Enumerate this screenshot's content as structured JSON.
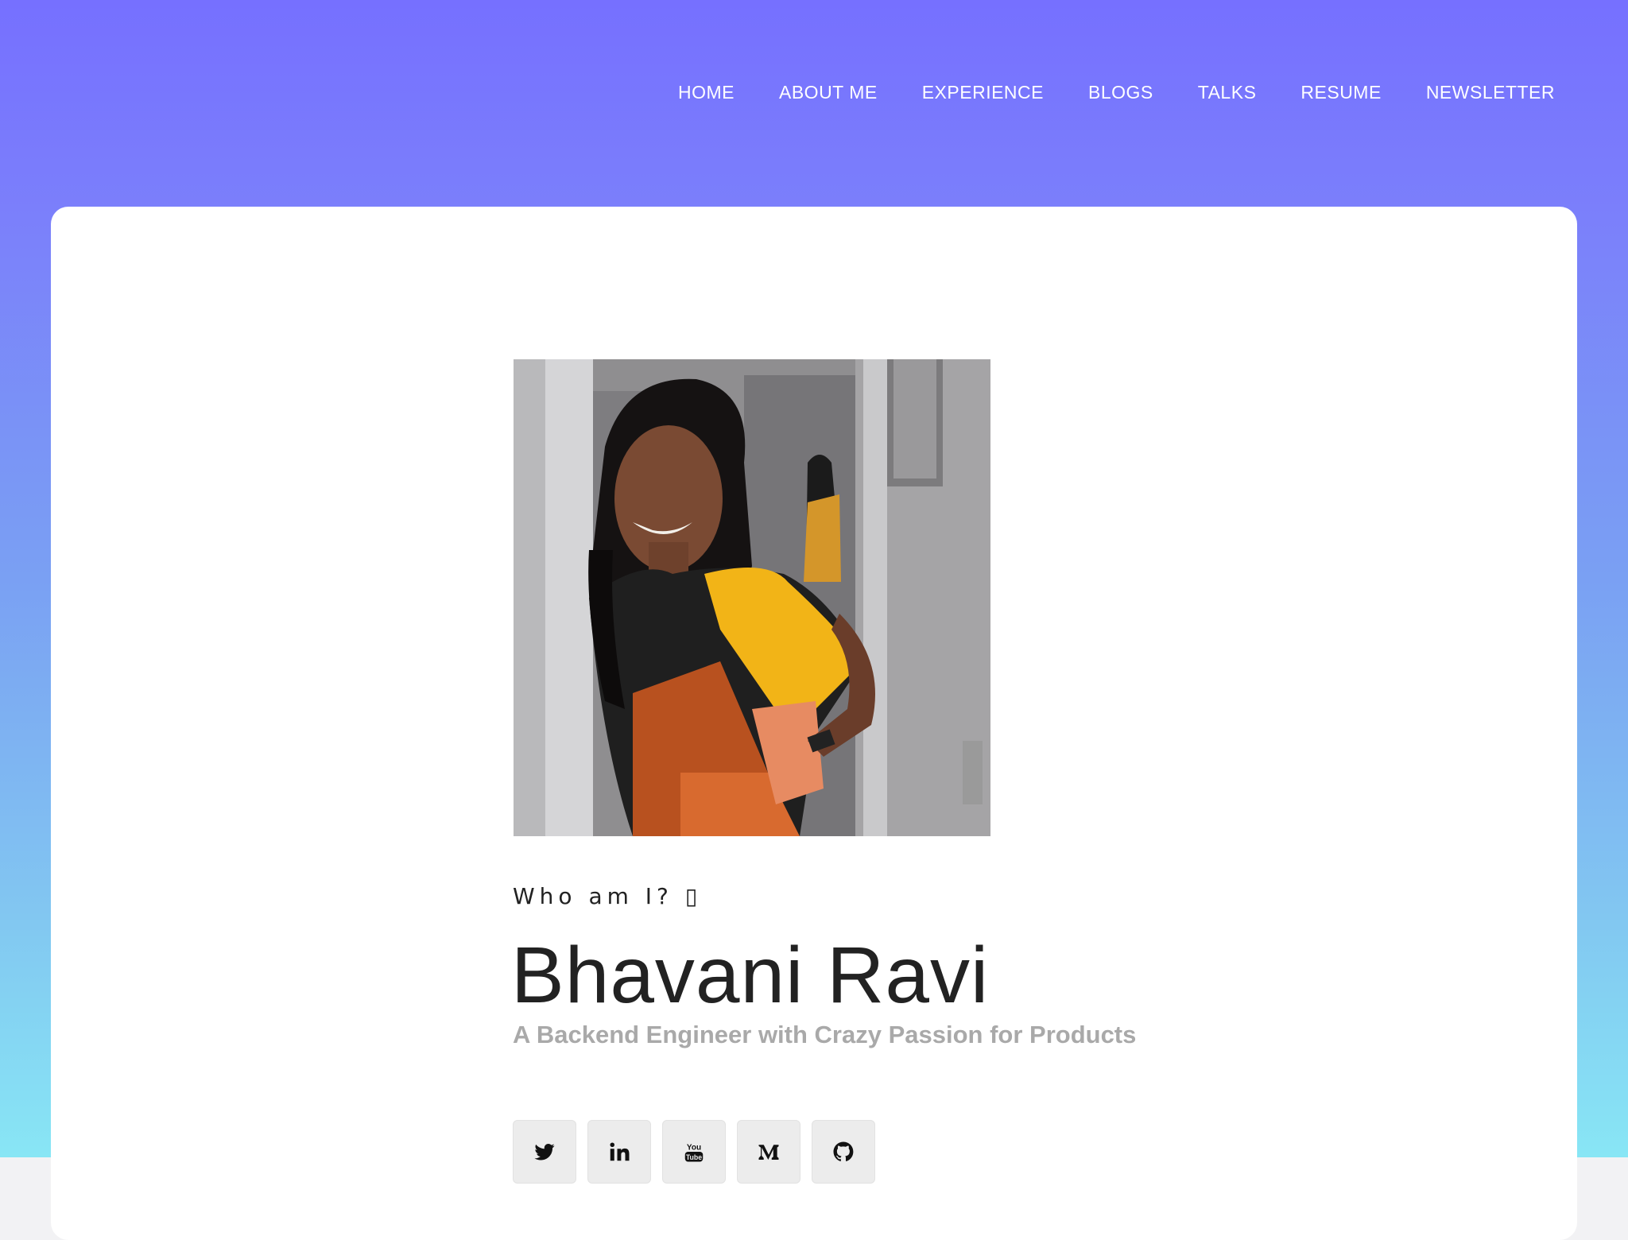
{
  "nav": {
    "items": [
      {
        "label": "HOME"
      },
      {
        "label": "ABOUT ME"
      },
      {
        "label": "EXPERIENCE"
      },
      {
        "label": "BLOGS"
      },
      {
        "label": "TALKS"
      },
      {
        "label": "RESUME"
      },
      {
        "label": "NEWSLETTER"
      }
    ]
  },
  "hero": {
    "eyebrow": "Who am I? ▯",
    "name": "Bhavani Ravi",
    "tagline": "A Backend Engineer with Crazy Passion for Products"
  },
  "socials": [
    {
      "icon": "twitter-icon"
    },
    {
      "icon": "linkedin-icon"
    },
    {
      "icon": "youtube-icon"
    },
    {
      "icon": "medium-icon"
    },
    {
      "icon": "github-icon"
    }
  ],
  "colors": {
    "gradient_top": "#7670ff",
    "gradient_bottom": "#88e6f5",
    "card": "#ffffff",
    "name_text": "#222222",
    "tagline_text": "#a9a9a9",
    "social_bg": "#ececec"
  }
}
